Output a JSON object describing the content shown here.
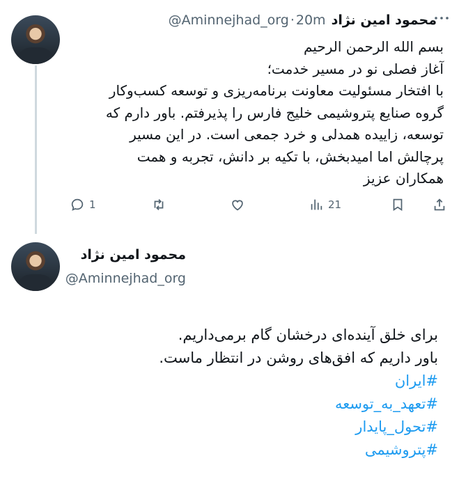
{
  "thread": {
    "first_tweet": {
      "author_name": "محمود امین نژاد",
      "author_handle": "@Aminnejhad_org",
      "separator": "·",
      "time": "20m",
      "lines": [
        "بسم الله الرحمن الرحیم",
        "آغاز فصلی نو در مسیر خدمت؛",
        "با افتخار مسئولیت معاونت برنامه‌ریزی و توسعه کسب‌وکار",
        "گروه صنایع پتروشیمی خلیج فارس را پذیرفتم. باور دارم که",
        "توسعه، زاییده همدلی و خرد جمعی است. در این مسیر",
        "پرچالش اما امیدبخش، با تکیه بر دانش، تجربه و همت",
        "همکاران عزیز"
      ],
      "actions": {
        "reply_count": "1",
        "retweet_count": "",
        "like_count": "",
        "views_count": "21"
      }
    },
    "second_tweet": {
      "author_name": "محمود امین نژاد",
      "author_handle": "@Aminnejhad_org",
      "lines": [
        "برای خلق آینده‌ای درخشان گام برمی‌داریم.",
        "باور داریم که افق‌های روشن در انتظار ماست."
      ],
      "hashtags": [
        "#ایران",
        "#تعهد_به_توسعه",
        "#تحول_پایدار",
        "#پتروشیمی"
      ]
    }
  },
  "colors": {
    "link": "#1d9bf0",
    "muted": "#536471",
    "text": "#0f1419",
    "thread_line": "#cfd9de"
  },
  "icons": {
    "reply": "reply-icon",
    "retweet": "retweet-icon",
    "like": "heart-icon",
    "views": "analytics-icon",
    "bookmark": "bookmark-icon",
    "share": "share-icon",
    "more": "more-icon"
  }
}
